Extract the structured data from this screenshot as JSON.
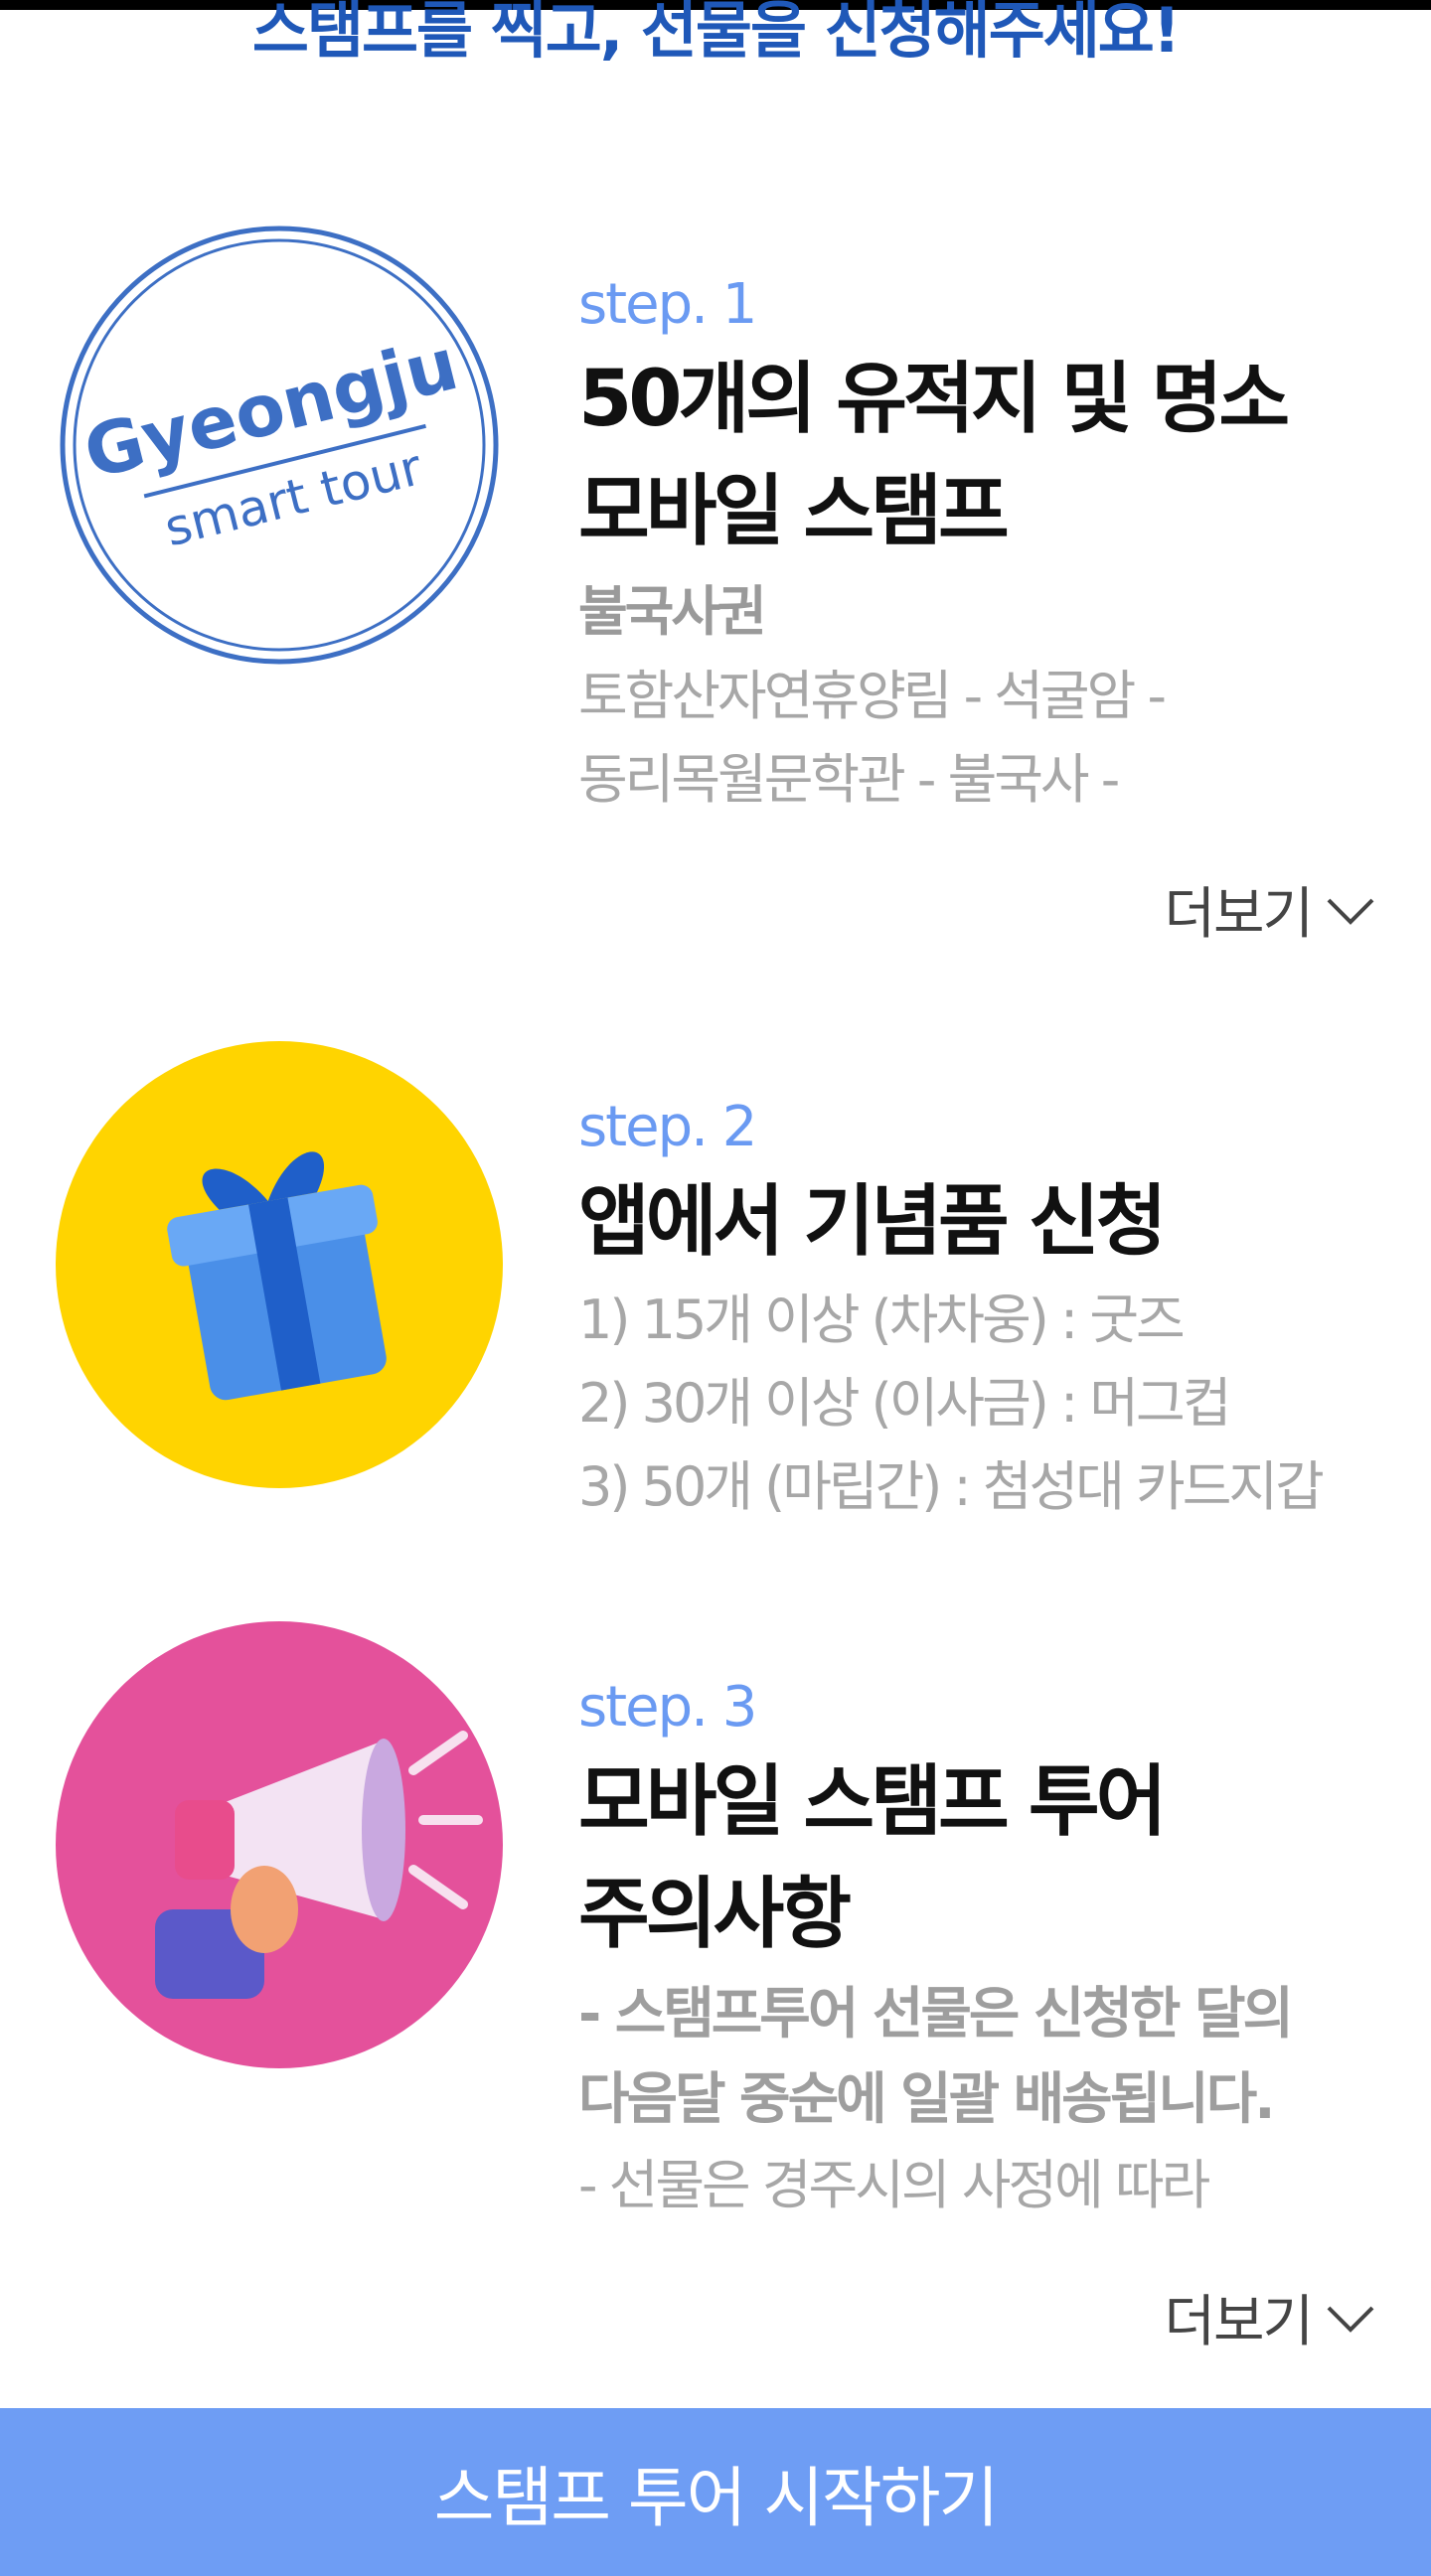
{
  "header": {
    "title": "스탬프를 찍고, 선물을 신청해주세요!"
  },
  "steps": [
    {
      "label": "step. 1",
      "title_line1": "50개의 유적지 및 명소",
      "title_line2": "모바일 스탬프",
      "region": "불국사권",
      "desc_line1": "토함산자연휴양림 - 석굴암 -",
      "desc_line2": "동리목월문학관 - 불국사 -",
      "stamp_line1": "Gyeongju",
      "stamp_line2": "smart tour",
      "more_label": "더보기"
    },
    {
      "label": "step. 2",
      "title": "앱에서 기념품 신청",
      "items": [
        "1) 15개 이상 (차차웅) : 굿즈",
        "2) 30개 이상 (이사금) : 머그컵",
        "3) 50개 (마립간) : 첨성대 카드지갑"
      ],
      "icon": "gift-icon",
      "bg_color": "#ffd400"
    },
    {
      "label": "step. 3",
      "title_line1": "모바일 스탬프 투어",
      "title_line2": "주의사항",
      "notice_line1": "- 스탬프투어 선물은 신청한 달의",
      "notice_line2": "다음달 중순에 일괄 배송됩니다.",
      "desc_line1": "- 선물은 경주시의 사정에 따라",
      "icon": "megaphone-icon",
      "bg_color": "#e4519b",
      "more_label": "더보기"
    }
  ],
  "cta": {
    "label": "스탬프 투어 시작하기",
    "bg_color": "#6e9df4"
  }
}
